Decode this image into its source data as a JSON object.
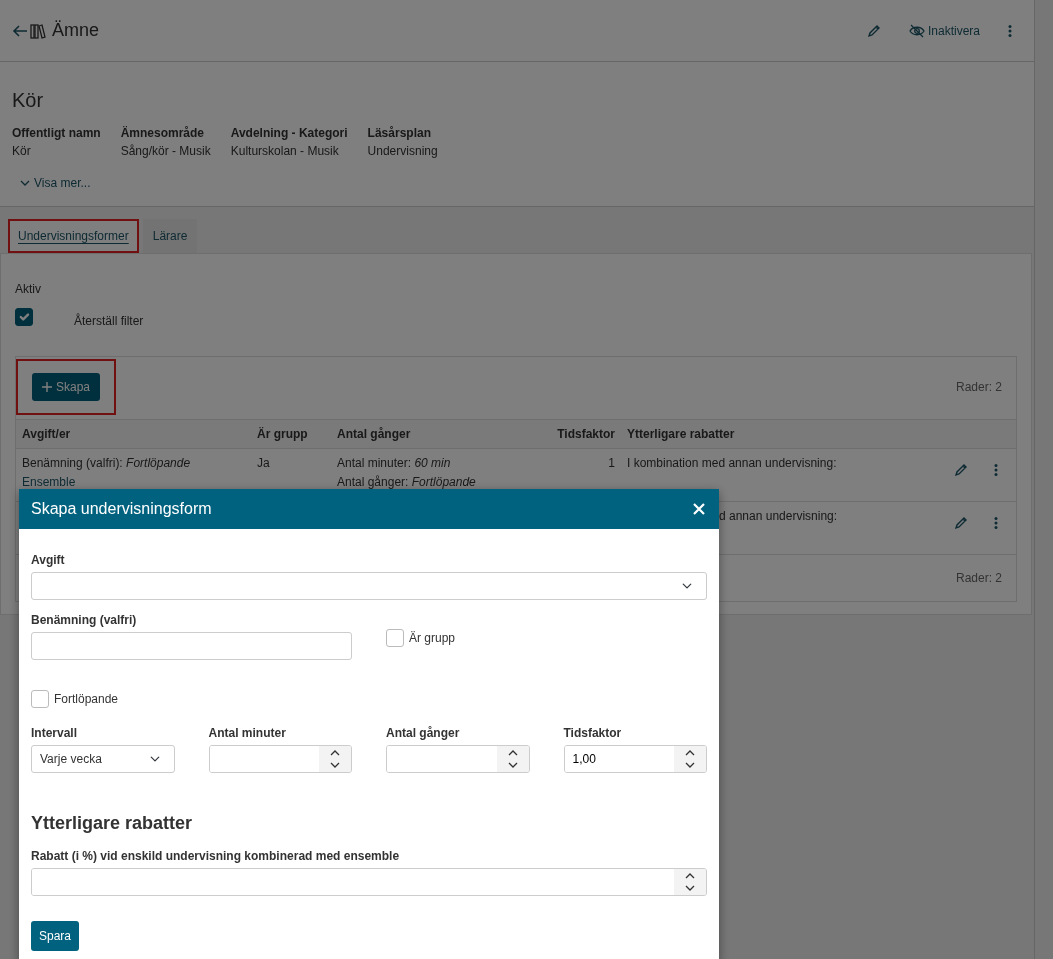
{
  "header": {
    "title": "Ämne",
    "actions": [
      {
        "kind": "edit"
      },
      {
        "kind": "deactivate",
        "label": "Inaktivera"
      },
      {
        "kind": "more"
      }
    ]
  },
  "subject": {
    "name": "Kör",
    "fields": [
      {
        "label": "Offentligt namn",
        "value": "Kör"
      },
      {
        "label": "Ämnesområde",
        "value": "Sång/kör - Musik"
      },
      {
        "label": "Avdelning - Kategori",
        "value": "Kulturskolan - Musik"
      },
      {
        "label": "Läsårsplan",
        "value": "Undervisning"
      }
    ],
    "show_more": "Visa mer..."
  },
  "tabs": [
    {
      "label": "Undervisningsformer",
      "selected": true,
      "highlighted": true
    },
    {
      "label": "Lärare",
      "selected": false,
      "highlighted": false
    }
  ],
  "filter": {
    "label": "Aktiv",
    "checked": true,
    "reset": "Återställ filter"
  },
  "table": {
    "create_button": {
      "label": "Skapa",
      "highlighted": true
    },
    "row_count": "Rader: 2",
    "columns": [
      "Avgift/er",
      "Är grupp",
      "Antal gånger",
      "Tidsfaktor",
      "Ytterligare rabatter"
    ],
    "rows": [
      {
        "fee": "Benämning (valfri): *Fortlöpande*",
        "fee_link": "Ensemble",
        "group": "Ja",
        "counts": [
          "Antal minuter: *60 min*",
          "Antal gånger: *Fortlöpande*"
        ],
        "factor": "1",
        "discounts": "I kombination med annan undervisning:"
      },
      {
        "discounts": "d annan undervisning:"
      }
    ],
    "footer_count": "Rader: 2"
  },
  "modal": {
    "title": "Skapa undervisningsform",
    "fee": {
      "label": "Avgift"
    },
    "name": {
      "label": "Benämning (valfri)"
    },
    "is_group": {
      "label": "Är grupp",
      "checked": false
    },
    "ongoing": {
      "label": "Fortlöpande",
      "checked": false
    },
    "numbers": [
      {
        "kind": "select",
        "label": "Intervall",
        "value": "Varje vecka"
      },
      {
        "kind": "number",
        "label": "Antal minuter"
      },
      {
        "kind": "number",
        "label": "Antal gånger"
      },
      {
        "kind": "number",
        "label": "Tidsfaktor",
        "value": "1,00"
      }
    ],
    "section": "Ytterligare rabatter",
    "discount": {
      "label": "Rabatt (i %) vid enskild undervisning kombinerad med ensemble"
    },
    "save": "Spara"
  }
}
